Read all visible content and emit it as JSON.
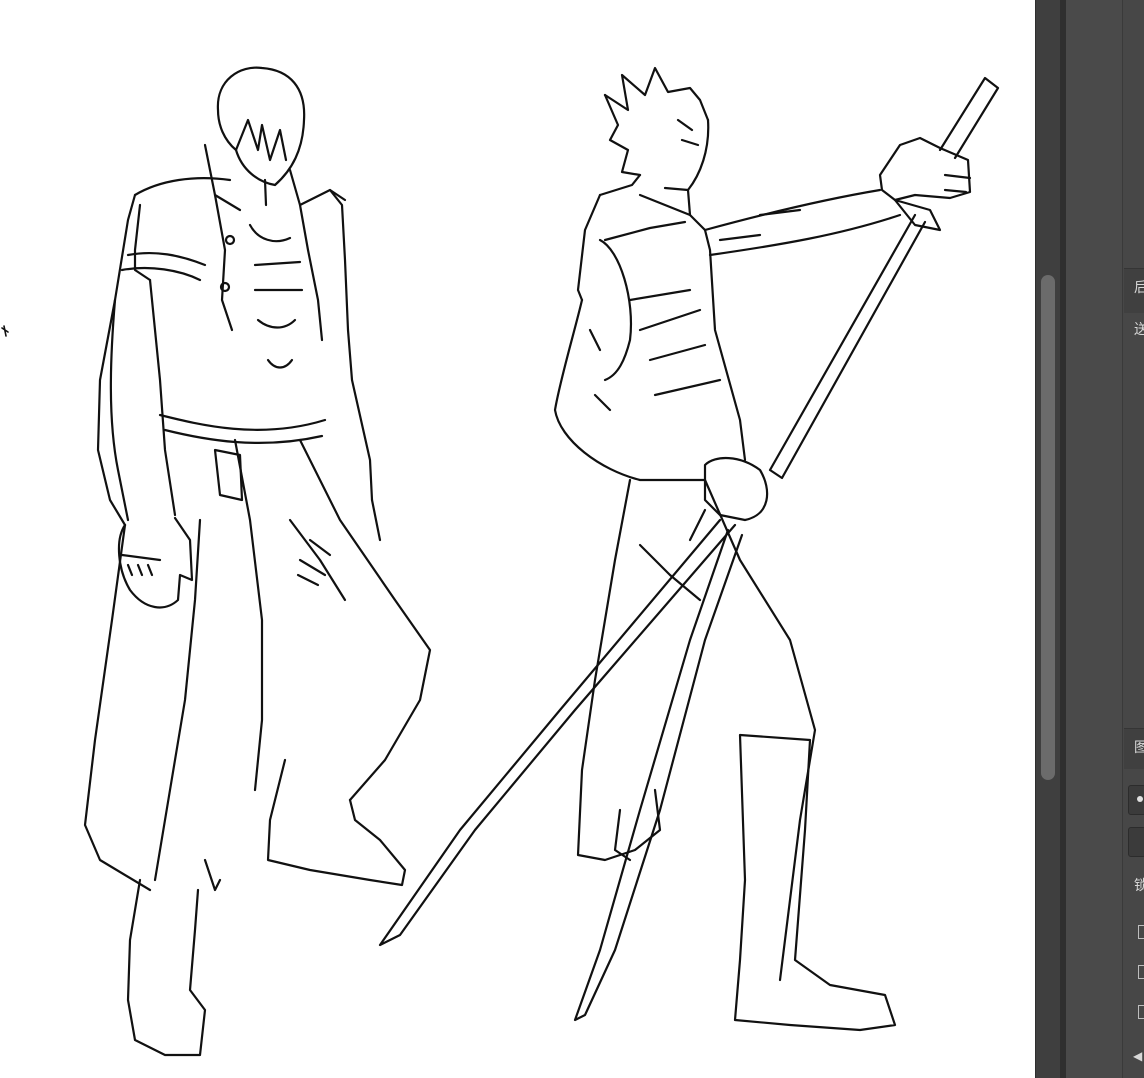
{
  "panel": {
    "glyph_1": "后",
    "glyph_2": "送",
    "glyph_3": "图",
    "glyph_4": "锁"
  }
}
